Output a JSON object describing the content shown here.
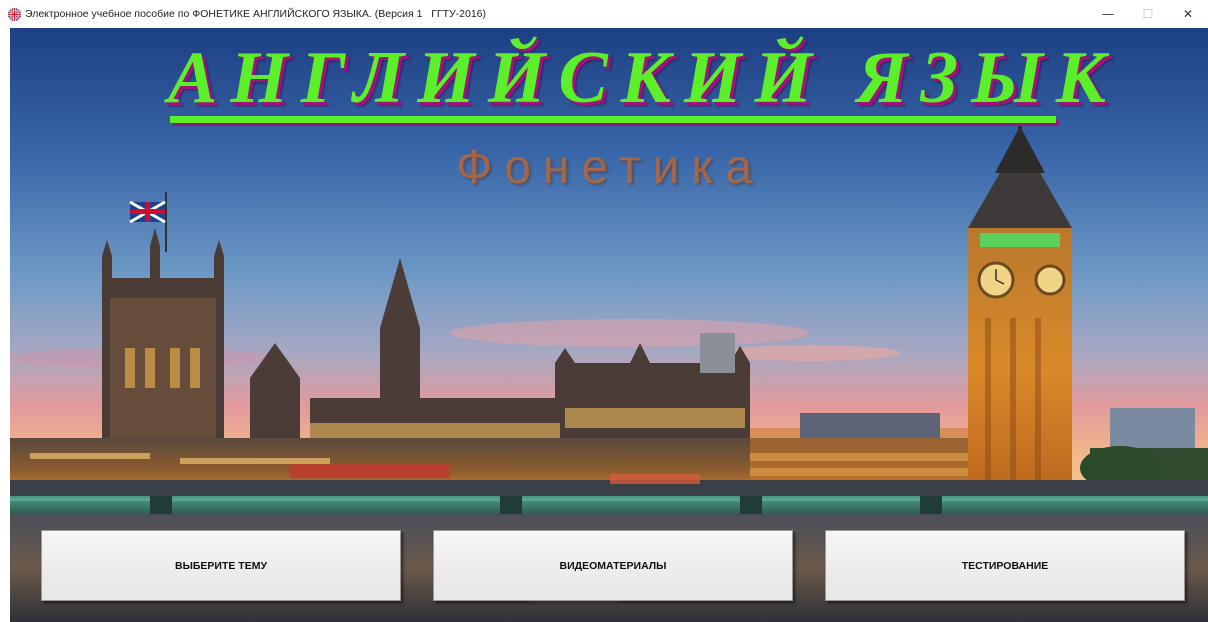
{
  "window": {
    "title": "Электронное учебное пособие по ФОНЕТИКЕ АНГЛИЙСКОГО ЯЗЫКА. (Версия 1   ГГТУ-2016)",
    "minimize": "—",
    "maximize": "☐",
    "close": "✕"
  },
  "header": {
    "title": "АНГЛИЙСКИЙ ЯЗЫК",
    "subtitle": "Фонетика"
  },
  "menu": {
    "topics_label": "ВЫБЕРИТЕ ТЕМУ",
    "video_label": "ВИДЕОМАТЕРИАЛЫ",
    "testing_label": "ТЕСТИРОВАНИЕ"
  },
  "colors": {
    "title_green": "#5cf02a",
    "title_shadow": "#a0137a",
    "subtitle_brown": "#be6937"
  },
  "icons": {
    "app": "union-jack-icon",
    "minimize": "minimize-icon",
    "maximize": "maximize-icon",
    "close": "close-icon"
  }
}
